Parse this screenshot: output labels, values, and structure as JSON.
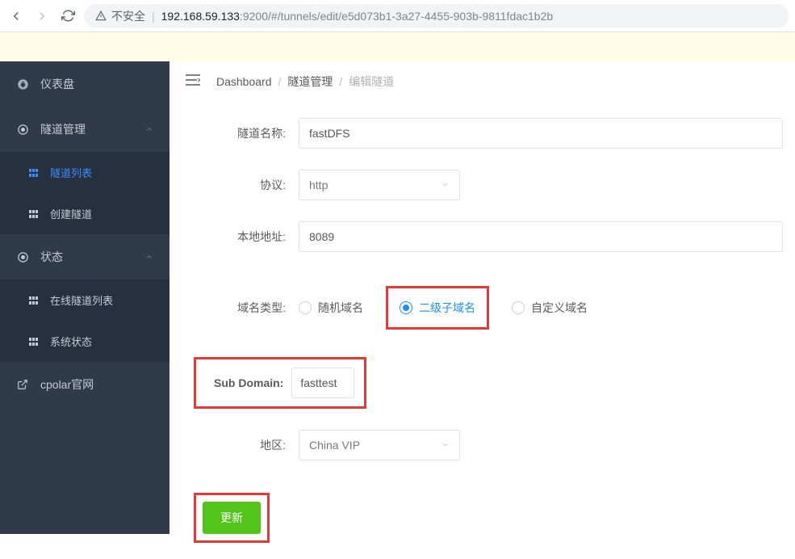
{
  "browser": {
    "insecure_label": "不安全",
    "url_host": "192.168.59.133",
    "url_port": ":9200",
    "url_path": "/#/tunnels/edit/e5d073b1-3a27-4455-903b-9811fdac1b2b"
  },
  "sidebar": {
    "dashboard": "仪表盘",
    "tunnel_mgmt": "隧道管理",
    "tunnel_list": "隧道列表",
    "create_tunnel": "创建隧道",
    "status": "状态",
    "online_tunnels": "在线隧道列表",
    "system_status": "系统状态",
    "cpolar_site": "cpolar官网"
  },
  "breadcrumb": {
    "dashboard": "Dashboard",
    "tunnel_mgmt": "隧道管理",
    "edit_tunnel": "编辑隧道"
  },
  "form": {
    "name_label": "隧道名称:",
    "name_value": "fastDFS",
    "protocol_label": "协议:",
    "protocol_value": "http",
    "local_addr_label": "本地地址:",
    "local_addr_value": "8089",
    "domain_type_label": "域名类型:",
    "domain_type_random": "随机域名",
    "domain_type_subdomain": "二级子域名",
    "domain_type_custom": "自定义域名",
    "subdomain_label": "Sub Domain:",
    "subdomain_value": "fasttest",
    "region_label": "地区:",
    "region_value": "China VIP",
    "submit_label": "更新"
  }
}
